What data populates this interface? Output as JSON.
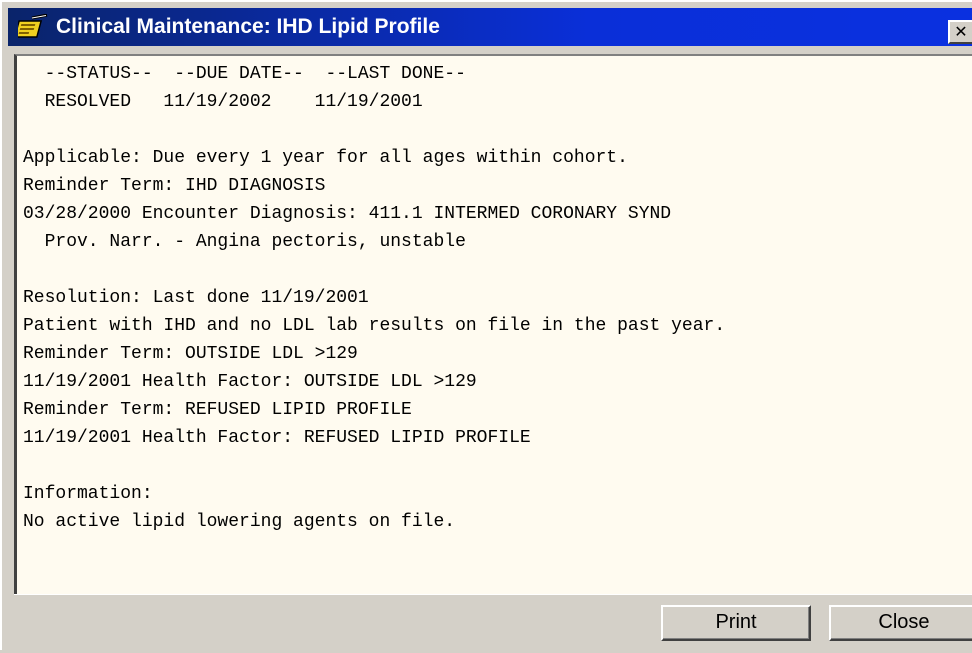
{
  "window": {
    "title": "Clinical Maintenance: IHD Lipid Profile",
    "icon": "clipboard-pencil-icon",
    "close_glyph": "✕"
  },
  "report": {
    "lines": [
      "  --STATUS--  --DUE DATE--  --LAST DONE--",
      "  RESOLVED   11/19/2002    11/19/2001",
      "",
      "Applicable: Due every 1 year for all ages within cohort.",
      "Reminder Term: IHD DIAGNOSIS",
      "03/28/2000 Encounter Diagnosis: 411.1 INTERMED CORONARY SYND",
      "  Prov. Narr. - Angina pectoris, unstable",
      "",
      "Resolution: Last done 11/19/2001",
      "Patient with IHD and no LDL lab results on file in the past year.",
      "Reminder Term: OUTSIDE LDL >129",
      "11/19/2001 Health Factor: OUTSIDE LDL >129",
      "Reminder Term: REFUSED LIPID PROFILE",
      "11/19/2001 Health Factor: REFUSED LIPID PROFILE",
      "",
      "Information:",
      "No active lipid lowering agents on file."
    ]
  },
  "buttons": {
    "print": "Print",
    "close": "Close"
  },
  "colors": {
    "titlebar": "#0a2fd8",
    "panel_background": "#fffbf0",
    "chrome": "#d4d0c8"
  }
}
